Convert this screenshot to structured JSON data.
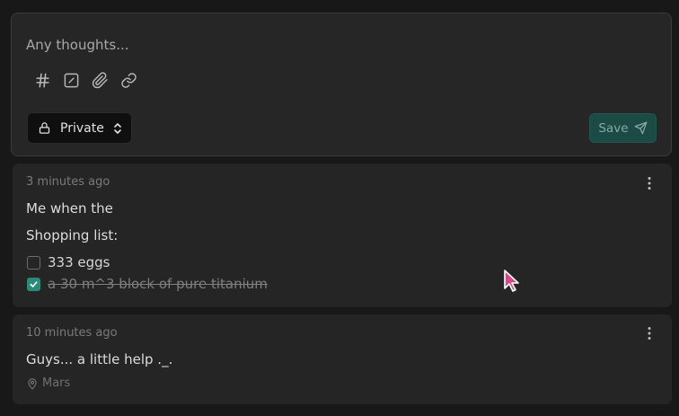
{
  "editor": {
    "placeholder": "Any thoughts...",
    "toolbar": [
      {
        "name": "hashtag-icon"
      },
      {
        "name": "checkbox-icon"
      },
      {
        "name": "attachment-icon"
      },
      {
        "name": "link-icon"
      }
    ],
    "visibility": {
      "label": "Private",
      "icon": "lock-icon"
    },
    "save_label": "Save"
  },
  "memos": [
    {
      "time": "3 minutes ago",
      "lines": [
        "Me when the",
        "Shopping list:"
      ],
      "tasks": [
        {
          "label": "333 eggs",
          "checked": false
        },
        {
          "label": "a 30 m^3 block of pure titanium",
          "checked": true
        }
      ]
    },
    {
      "time": "10 minutes ago",
      "text": "Guys... a little help ._.",
      "location": "Mars"
    }
  ],
  "colors": {
    "accent": "#2e8a78",
    "save_bg": "#1c4a44",
    "background": "#181818",
    "card": "#252525"
  }
}
